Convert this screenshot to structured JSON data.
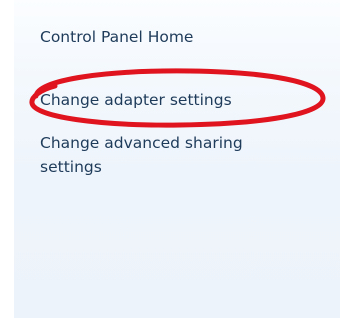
{
  "tasks": {
    "home_label": "Control Panel Home",
    "adapter_label": "Change adapter settings",
    "sharing_label_line1": "Change advanced sharing",
    "sharing_label_line2": "settings"
  },
  "colors": {
    "link_text": "#1e3b5a",
    "pane_bg": "#eef4fb",
    "highlight_ellipse": "#e0141e"
  }
}
